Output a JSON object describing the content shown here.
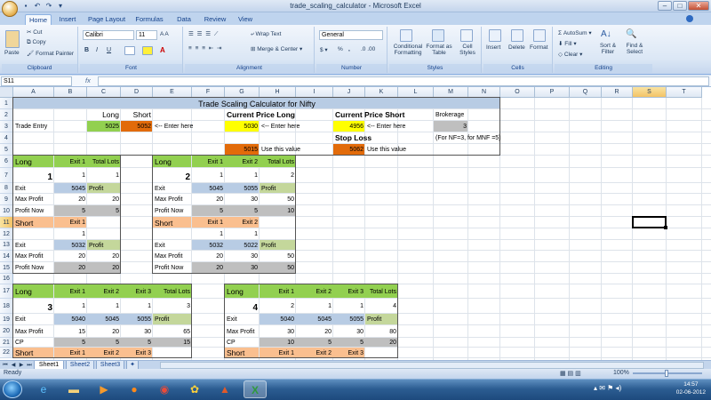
{
  "window": {
    "title": "trade_scaling_calculator - Microsoft Excel"
  },
  "tabs": [
    "Home",
    "Insert",
    "Page Layout",
    "Formulas",
    "Data",
    "Review",
    "View"
  ],
  "ribbon": {
    "clipboard": {
      "label": "Clipboard",
      "paste": "Paste",
      "cut": "Cut",
      "copy": "Copy",
      "format_painter": "Format Painter"
    },
    "font": {
      "label": "Font",
      "name": "Calibri",
      "size": "11",
      "bold": "B",
      "italic": "I",
      "underline": "U"
    },
    "alignment": {
      "label": "Alignment",
      "wrap": "Wrap Text",
      "merge": "Merge & Center"
    },
    "number": {
      "label": "Number",
      "format": "General",
      "currency": "$",
      "percent": "%",
      "comma": ","
    },
    "styles": {
      "label": "Styles",
      "conditional": "Conditional Formatting",
      "format_table": "Format as Table",
      "cell_styles": "Cell Styles"
    },
    "cells": {
      "label": "Cells",
      "insert": "Insert",
      "delete": "Delete",
      "format": "Format"
    },
    "editing": {
      "label": "Editing",
      "autosum": "AutoSum",
      "fill": "Fill",
      "clear": "Clear",
      "sort": "Sort & Filter",
      "find": "Find & Select"
    }
  },
  "formula_bar": {
    "name_box": "S11",
    "fx": "fx",
    "value": ""
  },
  "columns": [
    "A",
    "B",
    "C",
    "D",
    "E",
    "F",
    "G",
    "H",
    "I",
    "J",
    "K",
    "L",
    "M",
    "N",
    "O",
    "P",
    "Q",
    "R",
    "S",
    "T"
  ],
  "selected_column": "S",
  "rows": [
    "1",
    "2",
    "3",
    "4",
    "5",
    "6",
    "7",
    "8",
    "9",
    "10",
    "11",
    "12",
    "13",
    "14",
    "15",
    "16",
    "17",
    "18",
    "19",
    "20",
    "21",
    "22"
  ],
  "selected_row": "11",
  "cells": {
    "title": "Trade Scaling Calculator for Nifty",
    "long": "Long",
    "short": "Short",
    "trade_entry": "Trade Entry",
    "entry_long": "5025",
    "entry_short": "5052",
    "enter_here": "<-- Enter here",
    "cur_long": "Current Price Long",
    "cur_short": "Current Price Short",
    "cur_long_v": "5030",
    "cur_short_v": "4956",
    "brokerage": "Brokerage",
    "brokerage_v": "3",
    "stop_loss": "Stop Loss",
    "nf_note": "(For NF=3, for MNF =5)",
    "use_this": "Use this value",
    "sl_long": "5015",
    "sl_short": "5062",
    "exit1": "Exit 1",
    "exit2": "Exit 2",
    "exit3": "Exit 3",
    "total_lots": "Total Lots",
    "exit": "Exit",
    "max_profit": "Max Profit",
    "profit_now": "Profit Now",
    "profit": "Profit",
    "cp": "CP",
    "b1": "1",
    "b2": "2",
    "b3": "3",
    "b4": "4",
    "one": "1",
    "two": "2",
    "three": "3",
    "four": "4",
    "v5045": "5045",
    "v5055": "5055",
    "v5040": "5040",
    "v5032": "5032",
    "v5022": "5022",
    "v20": "20",
    "v30": "30",
    "v50": "50",
    "v5": "5",
    "v10": "10",
    "v15": "15",
    "v65": "65",
    "v80": "80"
  },
  "sheets": [
    "Sheet1",
    "Sheet2",
    "Sheet3"
  ],
  "status": {
    "ready": "Ready",
    "zoom": "100%"
  },
  "clock": {
    "time": "14:57",
    "date": "02-06-2012"
  }
}
